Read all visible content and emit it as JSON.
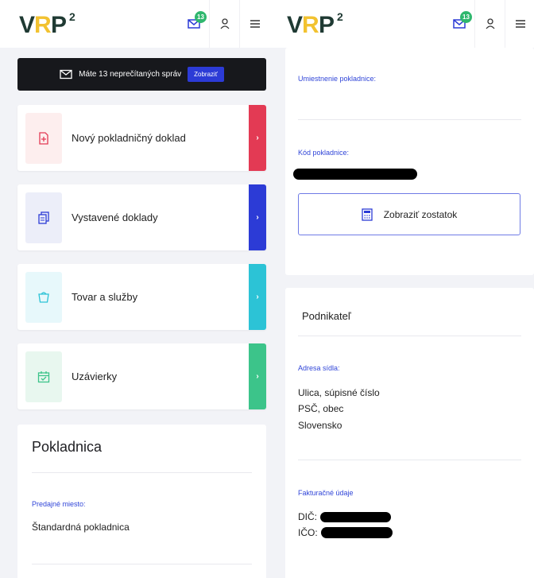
{
  "left": {
    "logo": "VRP²",
    "header_icons": [
      "mail-icon",
      "user-icon",
      "menu-icon"
    ],
    "unread_count": "13",
    "message_bar": {
      "text": "Máte 13 neprečítaných správ",
      "button": "Zobraziť"
    },
    "menu": [
      {
        "label": "Nový pokladničný doklad",
        "icon": "document-plus-icon",
        "accent": "#e33a54",
        "icon_bg": "#fdeeee",
        "icon_color": "#e33a54"
      },
      {
        "label": "Vystavené doklady",
        "icon": "documents-icon",
        "accent": "#2c3bd6",
        "icon_bg": "#eceef9",
        "icon_color": "#2c3bd6"
      },
      {
        "label": "Tovar a služby",
        "icon": "basket-icon",
        "accent": "#2cc3d6",
        "icon_bg": "#e7f8fb",
        "icon_color": "#2cc3d6"
      },
      {
        "label": "Uzávierky",
        "icon": "calendar-check-icon",
        "accent": "#3cc48a",
        "icon_bg": "#e8f7ef",
        "icon_color": "#3cc48a"
      }
    ],
    "pokladnica": {
      "title": "Pokladnica",
      "field_label": "Predajné miesto:",
      "field_value": "Štandardná pokladnica"
    }
  },
  "right": {
    "logo": "VRP²",
    "header_icons": [
      "mail-icon",
      "user-icon",
      "menu-icon"
    ],
    "unread_count": "13",
    "location_label": "Umiestnenie pokladnice:",
    "code_label": "Kód pokladnice:",
    "balance_button": "Zobraziť zostatok",
    "entrepreneur": {
      "title": "Podnikateľ",
      "address_label": "Adresa sídla:",
      "address_line1": "Ulica, súpisné číslo",
      "address_line2": "PSČ, obec",
      "address_line3": "Slovensko",
      "billing_label": "Fakturačné údaje",
      "dic_label": "DIČ:",
      "ico_label": "IČO:"
    }
  },
  "colors": {
    "accent_blue": "#2c3bd6",
    "label_blue": "#3146d8",
    "badge_green": "#2fb76e",
    "logo_dark": "#1f3a33",
    "logo_yellow": "#f2c230"
  }
}
